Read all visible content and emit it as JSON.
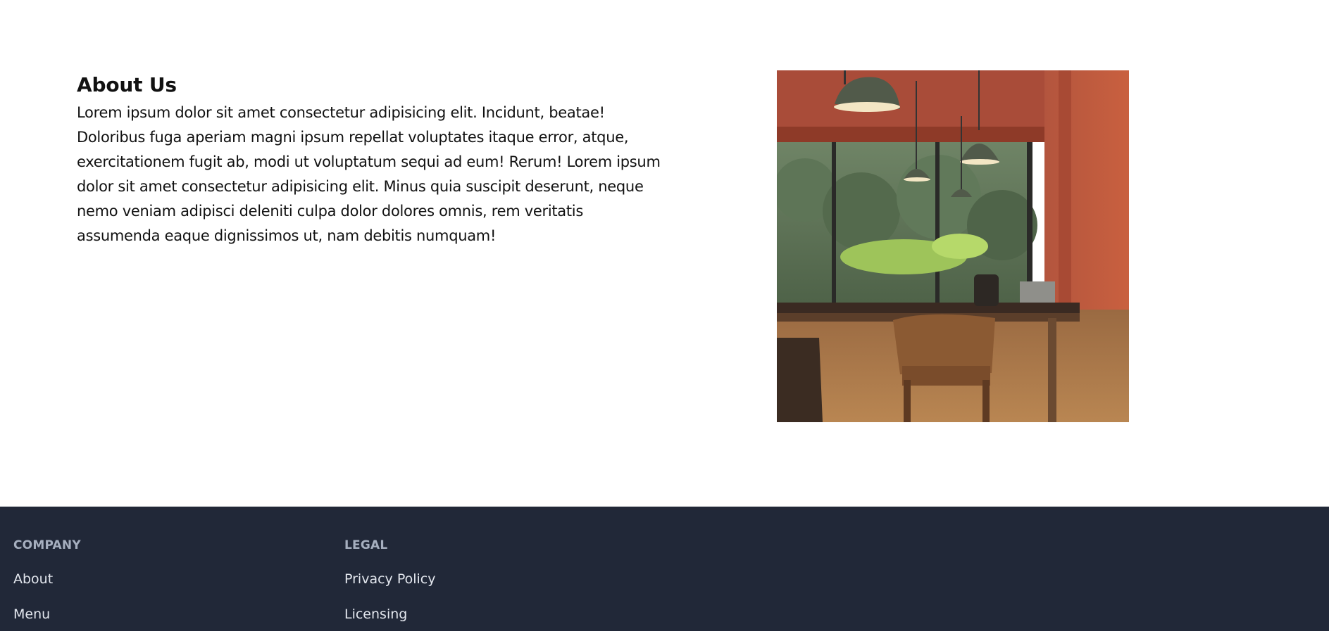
{
  "about": {
    "title": "About Us",
    "body": "Lorem ipsum dolor sit amet consectetur adipisicing elit. Incidunt, beatae! Doloribus fuga aperiam magni ipsum repellat voluptates itaque error, atque, exercitationem fugit ab, modi ut voluptatum sequi ad eum! Rerum! Lorem ipsum dolor sit amet consectetur adipisicing elit. Minus quia suscipit deserunt, neque nemo veniam adipisci deleniti culpa dolor dolores omnis, rem veritatis assumenda eaque dignissimos ut, nam debitis numquam!"
  },
  "footer": {
    "company": {
      "heading": "COMPANY",
      "links": [
        "About",
        "Menu"
      ]
    },
    "legal": {
      "heading": "LEGAL",
      "links": [
        "Privacy Policy",
        "Licensing"
      ]
    }
  },
  "colors": {
    "footer_background": "#212838",
    "footer_heading": "#a6afbf",
    "footer_link": "#e3e7ee",
    "text": "#111111"
  }
}
